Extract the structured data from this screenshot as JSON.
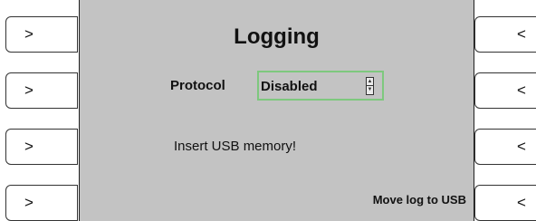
{
  "screen": {
    "title": "Logging",
    "protocol_label": "Protocol",
    "protocol_value": "Disabled",
    "message": "Insert USB memory!",
    "move_log_label": "Move log to USB"
  },
  "left_buttons": [
    ">",
    ">",
    ">",
    ">"
  ],
  "right_buttons": [
    "<",
    "<",
    "<",
    "<"
  ],
  "colors": {
    "screen_bg": "#c3c3c3",
    "select_border": "#7ec87e"
  },
  "icons": {
    "spinner": "up-down-arrows-icon"
  }
}
